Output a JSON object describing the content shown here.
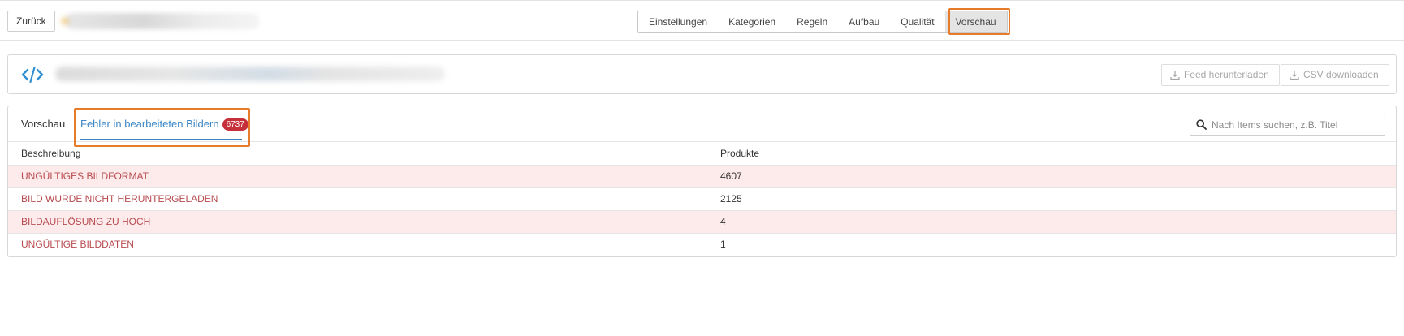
{
  "topbar": {
    "back_label": "Zurück",
    "tabs": [
      {
        "label": "Einstellungen"
      },
      {
        "label": "Kategorien"
      },
      {
        "label": "Regeln"
      },
      {
        "label": "Aufbau"
      },
      {
        "label": "Qualität"
      },
      {
        "label": "Vorschau",
        "active": true
      }
    ]
  },
  "feed": {
    "download_feed_label": "Feed herunterladen",
    "download_csv_label": "CSV downloaden"
  },
  "results": {
    "tabs": {
      "preview_label": "Vorschau",
      "errors_label": "Fehler in bearbeiteten Bildern",
      "errors_count": "6737"
    },
    "search": {
      "placeholder": "Nach Items suchen, z.B. Titel",
      "value": ""
    },
    "table": {
      "headers": {
        "description": "Beschreibung",
        "products": "Produkte"
      },
      "rows": [
        {
          "description": "UNGÜLTIGES BILDFORMAT",
          "products": "4607"
        },
        {
          "description": "BILD WURDE NICHT HERUNTERGELADEN",
          "products": "2125"
        },
        {
          "description": "BILDAUFLÖSUNG ZU HOCH",
          "products": "4"
        },
        {
          "description": "UNGÜLTIGE BILDDATEN",
          "products": "1"
        }
      ]
    }
  },
  "colors": {
    "accent_blue": "#3b86c6",
    "highlight_orange": "#e87a2b",
    "badge_red": "#c6303b",
    "error_text": "#b84b50",
    "error_row_bg": "#fdeaea"
  },
  "icons": {
    "code": "code-icon",
    "download": "download-icon",
    "search": "search-icon"
  }
}
